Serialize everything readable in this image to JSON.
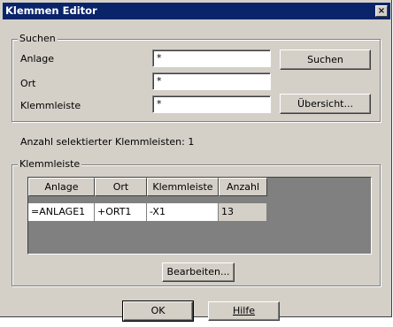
{
  "window": {
    "title": "Klemmen Editor",
    "close_glyph": "×"
  },
  "search": {
    "group_title": "Suchen",
    "fields": [
      {
        "label": "Anlage",
        "value": "*"
      },
      {
        "label": "Ort",
        "value": "*"
      },
      {
        "label": "Klemmleiste",
        "value": "*"
      }
    ],
    "search_button": "Suchen",
    "overview_button": "Übersicht..."
  },
  "status": {
    "text": "Anzahl selektierter Klemmleisten: 1"
  },
  "result": {
    "group_title": "Klemmleiste",
    "columns": [
      "Anlage",
      "Ort",
      "Klemmleiste",
      "Anzahl"
    ],
    "rows": [
      [
        "=ANLAGE1",
        "+ORT1",
        "-X1",
        "13"
      ]
    ],
    "edit_button": "Bearbeiten..."
  },
  "footer": {
    "ok_button": "OK",
    "help_button": "Hilfe"
  },
  "icons": {
    "close": "close-icon"
  }
}
